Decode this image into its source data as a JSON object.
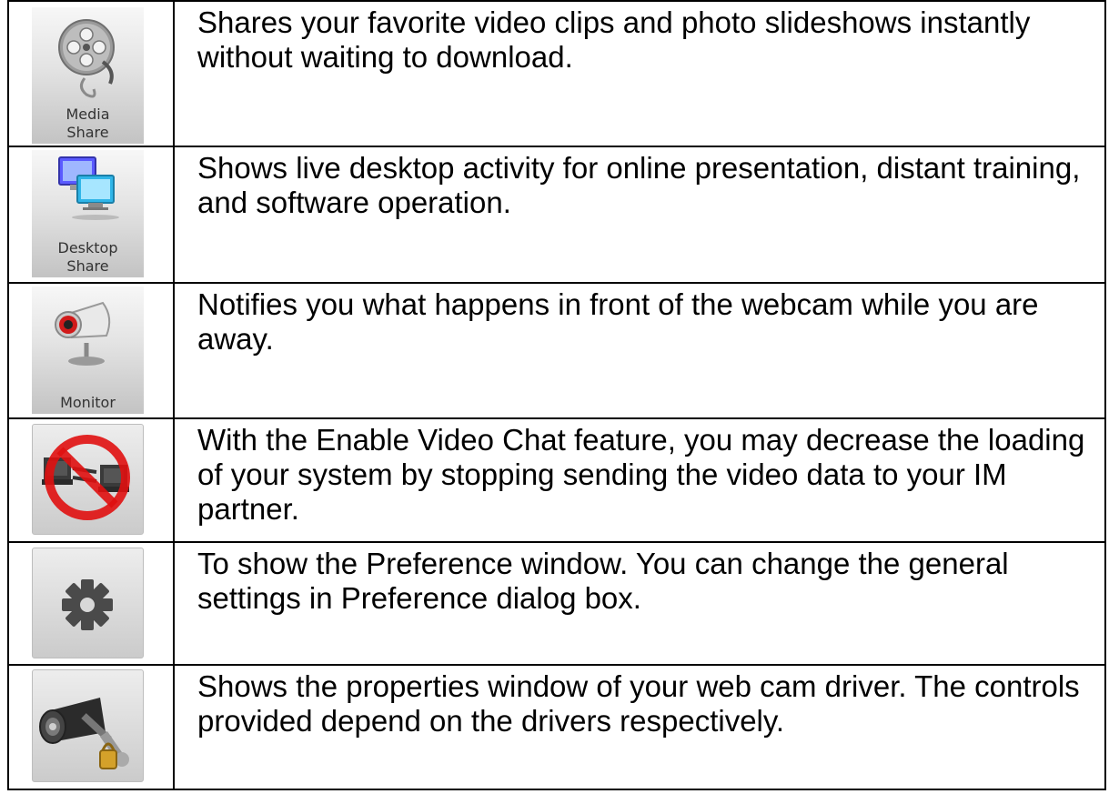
{
  "rows": [
    {
      "icon": "media-share-icon",
      "icon_label": "Media\nShare",
      "description": "Shares your favorite video clips and photo slideshows instantly without waiting to download."
    },
    {
      "icon": "desktop-share-icon",
      "icon_label": "Desktop\nShare",
      "description": "Shows live desktop activity for online presentation, distant training, and software operation."
    },
    {
      "icon": "monitor-icon",
      "icon_label": "Monitor",
      "description": "Notifies you what happens in front of the webcam while you are away."
    },
    {
      "icon": "disable-video-chat-icon",
      "icon_label": "",
      "description": "With the Enable Video Chat feature, you may decrease the loading of your system by stopping sending the video data to your IM partner."
    },
    {
      "icon": "gear-icon",
      "icon_label": "",
      "description": "To show the Preference window. You can change the general settings in Preference dialog box."
    },
    {
      "icon": "webcam-properties-icon",
      "icon_label": "",
      "description": "Shows the properties window of your web cam driver. The controls provided depend on the drivers respectively."
    }
  ]
}
